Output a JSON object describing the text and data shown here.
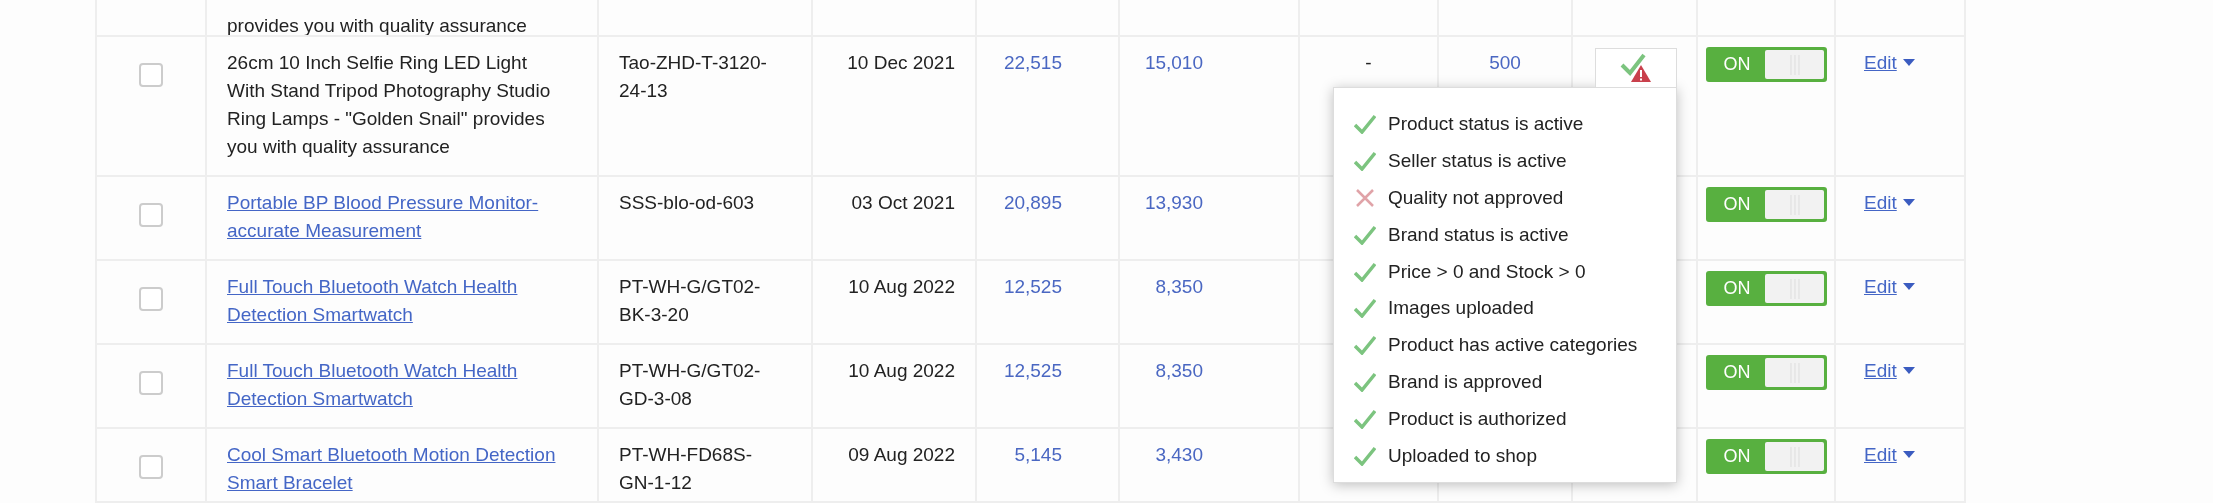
{
  "table": {
    "top_row": {
      "name_tail": "provides you with quality assurance"
    },
    "rows": [
      {
        "checked": false,
        "name": "26cm 10 Inch Selfie Ring LED Light With Stand Tripod Photography Studio Ring Lamps - \"Golden Snail\" provides you with quality assurance",
        "link": false,
        "sku": "Tao-ZHD-T-3120-24-13",
        "date": "10 Dec 2021",
        "column_5": "22,515",
        "column_6": "15,010",
        "column_7": "-",
        "column_8": "500",
        "toggle": {
          "label": "ON",
          "on": true
        },
        "action": "Edit"
      },
      {
        "checked": false,
        "name": "Portable BP Blood Pressure Monitor-accurate Measurement",
        "link": true,
        "sku": "SSS-blo-od-603",
        "date": "03 Oct 2021",
        "column_5": "20,895",
        "column_6": "13,930",
        "toggle": {
          "label": "ON",
          "on": true
        },
        "action": "Edit"
      },
      {
        "checked": false,
        "name": "Full Touch Bluetooth Watch Health Detection Smartwatch",
        "link": true,
        "sku": "PT-WH-G/GT02-BK-3-20",
        "date": "10 Aug 2022",
        "column_5": "12,525",
        "column_6": "8,350",
        "toggle": {
          "label": "ON",
          "on": true
        },
        "action": "Edit"
      },
      {
        "checked": false,
        "name": "Full Touch Bluetooth Watch Health Detection Smartwatch",
        "link": true,
        "sku": "PT-WH-G/GT02-GD-3-08",
        "date": "10 Aug 2022",
        "column_5": "12,525",
        "column_6": "8,350",
        "toggle": {
          "label": "ON",
          "on": true
        },
        "action": "Edit"
      },
      {
        "checked": false,
        "name": "Cool Smart Bluetooth Motion Detection Smart Bracelet",
        "link": true,
        "sku": "PT-WH-FD68S-GN-1-12",
        "date": "09 Aug 2022",
        "column_5": "5,145",
        "column_6": "3,430",
        "toggle": {
          "label": "ON",
          "on": true
        },
        "action": "Edit"
      }
    ]
  },
  "status_popup": {
    "items": [
      {
        "label": "Product status is active",
        "passed": true
      },
      {
        "label": "Seller status is active",
        "passed": true
      },
      {
        "label": "Quality not approved",
        "passed": false
      },
      {
        "label": "Brand status is active",
        "passed": true
      },
      {
        "label": "Price > 0 and Stock > 0",
        "passed": true
      },
      {
        "label": "Images uploaded",
        "passed": true
      },
      {
        "label": "Product has active categories",
        "passed": true
      },
      {
        "label": "Brand is approved",
        "passed": true
      },
      {
        "label": "Product is authorized",
        "passed": true
      },
      {
        "label": "Uploaded to shop",
        "passed": true
      }
    ]
  }
}
